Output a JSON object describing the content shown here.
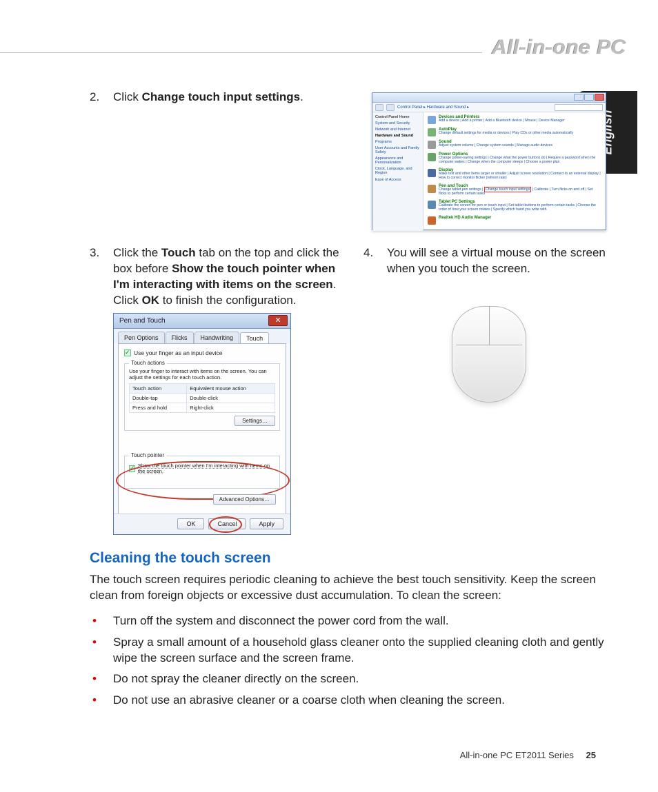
{
  "page_title": "All-in-one PC",
  "language_tab": "English",
  "step2": {
    "num": "2.",
    "pre": "Click ",
    "bold": "Change touch input settings",
    "post": "."
  },
  "control_panel": {
    "breadcrumb": "Control Panel ▸ Hardware and Sound ▸",
    "sidebar_title": "Control Panel Home",
    "sidebar": [
      "System and Security",
      "Network and Internet",
      "Hardware and Sound",
      "Programs",
      "User Accounts and Family Safety",
      "Appearance and Personalization",
      "Clock, Language, and Region",
      "Ease of Access"
    ],
    "active_sidebar_index": 2,
    "categories": {
      "devices": {
        "title": "Devices and Printers",
        "links": "Add a device | Add a printer | Add a Bluetooth device | Mouse | Device Manager"
      },
      "autoplay": {
        "title": "AutoPlay",
        "links": "Change default settings for media or devices | Play CDs or other media automatically"
      },
      "sound": {
        "title": "Sound",
        "links": "Adjust system volume | Change system sounds | Manage audio devices"
      },
      "power": {
        "title": "Power Options",
        "links": "Change power-saving settings | Change what the power buttons do | Require a password when the computer wakes | Change when the computer sleeps | Choose a power plan"
      },
      "display": {
        "title": "Display",
        "links": "Make text and other items larger or smaller | Adjust screen resolution | Connect to an external display | How to correct monitor flicker (refresh rate)"
      },
      "pen": {
        "title": "Pen and Touch",
        "links_pre": "Change tablet pen settings | ",
        "highlight": "Change touch input settings",
        "links_post": " | Calibrate | Turn flicks on and off | Set flicks to perform certain tasks"
      },
      "tablet": {
        "title": "Tablet PC Settings",
        "links": "Calibrate the screen for pen or touch input | Set tablet buttons to perform certain tasks | Choose the order of how your screen rotates | Specify which hand you write with"
      },
      "realtek": {
        "title": "Realtek HD Audio Manager",
        "links": ""
      }
    }
  },
  "step3": {
    "num": "3.",
    "t1": "Click the ",
    "b1": "Touch",
    "t2": " tab on the top and click the box before ",
    "b2": "Show the touch pointer when I'm interacting with items on the screen",
    "t3": ". Click ",
    "b3": "OK",
    "t4": " to finish the configuration."
  },
  "step4": {
    "num": "4.",
    "text": "You will see a virtual mouse on the screen when you touch the screen."
  },
  "pen_touch": {
    "title": "Pen and Touch",
    "tabs": [
      "Pen Options",
      "Flicks",
      "Handwriting",
      "Touch"
    ],
    "active_tab_index": 3,
    "checkbox1": "Use your finger as an input device",
    "group_title": "Touch actions",
    "group_desc": "Use your finger to interact with items on the screen. You can adjust the settings for each touch action.",
    "col1": "Touch action",
    "col2": "Equivalent mouse action",
    "rows": [
      {
        "a": "Double-tap",
        "b": "Double-click"
      },
      {
        "a": "Press and hold",
        "b": "Right-click"
      }
    ],
    "settings_btn": "Settings…",
    "pointer_group": "Touch pointer",
    "checkbox2": "Show the touch pointer when I'm interacting with items on the screen.",
    "advanced_btn": "Advanced Options…",
    "ok": "OK",
    "cancel": "Cancel",
    "apply": "Apply"
  },
  "cleaning": {
    "heading": "Cleaning the touch screen",
    "intro": "The touch screen requires periodic cleaning to achieve the best touch sensitivity. Keep the screen clean from foreign objects or excessive dust accumulation. To clean the screen:",
    "bullets": [
      "Turn off the system and disconnect the power cord from the wall.",
      "Spray a small amount of a household glass cleaner onto the supplied cleaning cloth and gently wipe the screen surface and the screen frame.",
      "Do not spray the cleaner directly on the screen.",
      "Do not use an abrasive cleaner or a coarse cloth when cleaning the screen."
    ]
  },
  "footer": {
    "model": "All-in-one PC ET2011 Series",
    "page": "25"
  }
}
